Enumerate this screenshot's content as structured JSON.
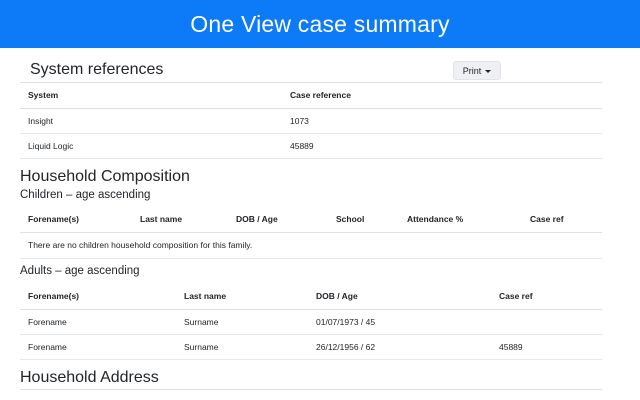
{
  "header": {
    "title": "One View case summary"
  },
  "system_references": {
    "title": "System references",
    "print_label": "Print",
    "columns": [
      "System",
      "Case reference"
    ],
    "rows": [
      [
        "Insight",
        "1073"
      ],
      [
        "Liquid Logic",
        "45889"
      ]
    ]
  },
  "household_composition": {
    "title": "Household Composition",
    "children": {
      "subtitle": "Children – age ascending",
      "columns": [
        "Forename(s)",
        "Last name",
        "DOB / Age",
        "School",
        "Attendance %",
        "Case ref"
      ],
      "empty_message": "There are no children household composition for this family."
    },
    "adults": {
      "subtitle": "Adults – age ascending",
      "columns": [
        "Forename(s)",
        "Last name",
        "DOB / Age",
        "Case ref"
      ],
      "rows": [
        [
          "Forename",
          "Surname",
          "01/07/1973 / 45",
          ""
        ],
        [
          "Forename",
          "Surname",
          "26/12/1956 / 62",
          "45889"
        ]
      ]
    }
  },
  "household_address": {
    "title": "Household Address"
  },
  "colors": {
    "header_bg": "#0d7bf7",
    "header_text": "#ffffff",
    "button_bg": "#eef0f3"
  },
  "icons": {
    "print_caret": "caret-down-icon"
  }
}
